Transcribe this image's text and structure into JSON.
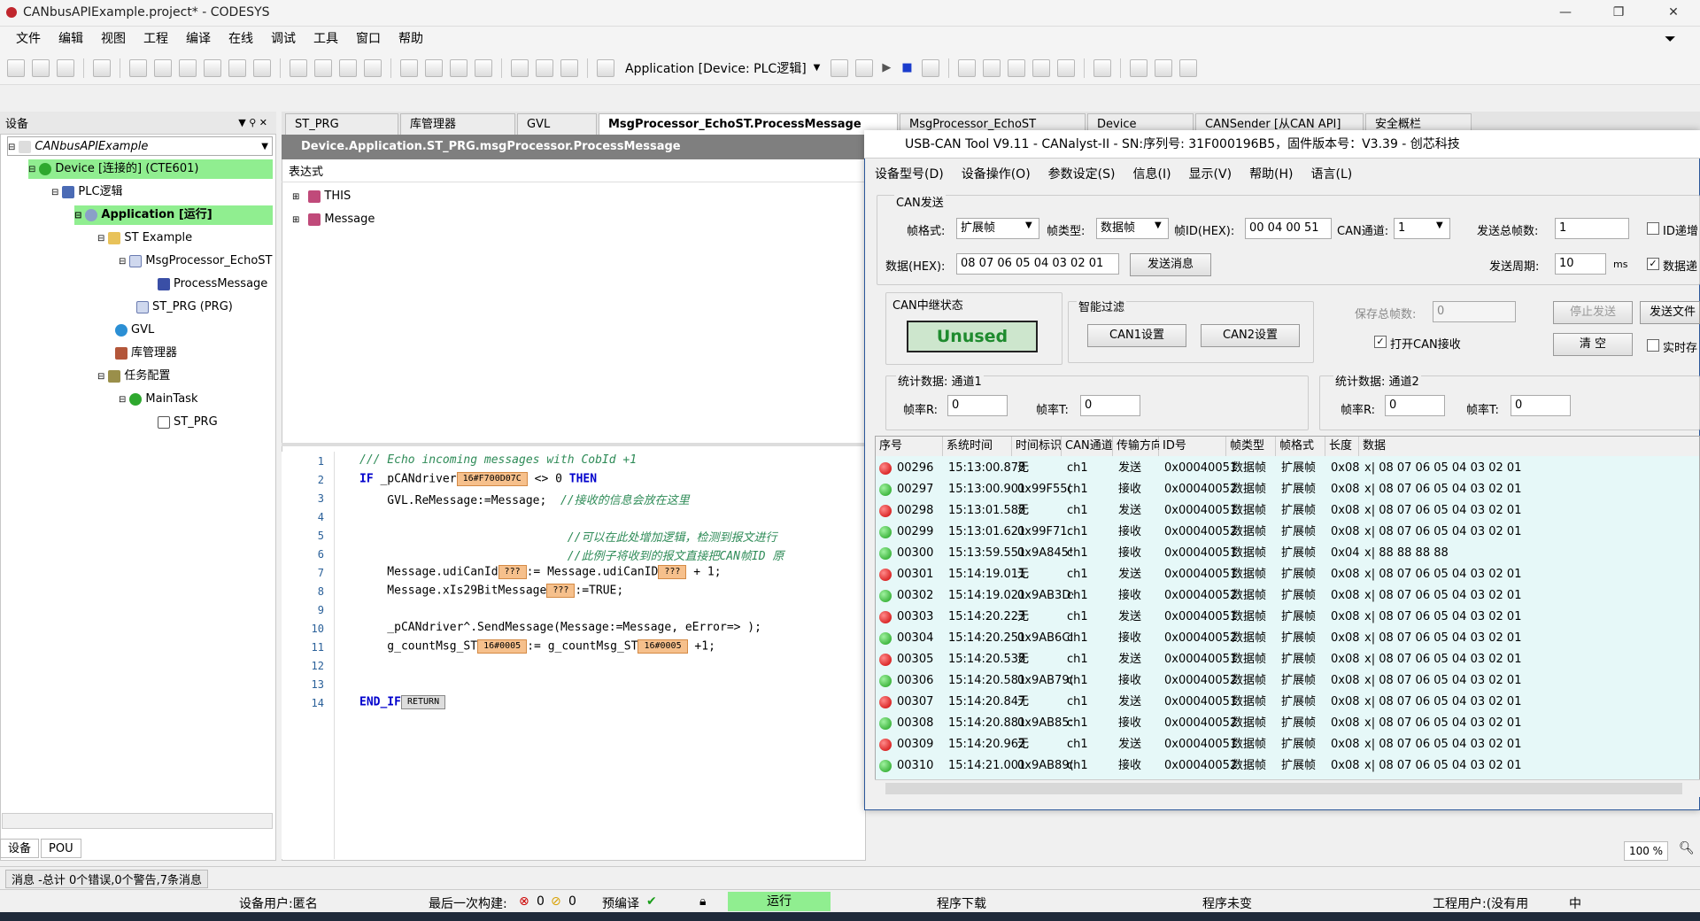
{
  "window": {
    "title": "CANbusAPIExample.project* - CODESYS",
    "min": "—",
    "max": "❐",
    "close": "✕"
  },
  "menu": [
    "文件",
    "编辑",
    "视图",
    "工程",
    "编译",
    "在线",
    "调试",
    "工具",
    "窗口",
    "帮助"
  ],
  "toolbar": {
    "app_selector": "Application [Device: PLC逻辑]"
  },
  "devices_panel": {
    "title": "设备",
    "tree": [
      {
        "label": "CANbusAPIExample",
        "icon": "project-icon"
      },
      {
        "label": "Device [连接的] (CTE601)",
        "icon": "device-icon"
      },
      {
        "label": "PLC逻辑",
        "icon": "plc-icon"
      },
      {
        "label": "Application [运行]",
        "icon": "gear-icon"
      },
      {
        "label": "ST Example",
        "icon": "folder-icon"
      },
      {
        "label": "MsgProcessor_EchoST",
        "icon": "fb-icon"
      },
      {
        "label": "ProcessMessage",
        "icon": "method-icon"
      },
      {
        "label": "ST_PRG (PRG)",
        "icon": "prg-icon"
      },
      {
        "label": "GVL",
        "icon": "globe-icon"
      },
      {
        "label": "库管理器",
        "icon": "library-icon"
      },
      {
        "label": "任务配置",
        "icon": "task-config-icon"
      },
      {
        "label": "MainTask",
        "icon": "task-icon"
      },
      {
        "label": "ST_PRG",
        "icon": "prg-icon"
      }
    ],
    "bottom_tabs": [
      "设备",
      "POU"
    ]
  },
  "doc_tabs": [
    "ST_PRG",
    "库管理器",
    "GVL",
    "MsgProcessor_EchoST.ProcessMessage",
    "MsgProcessor_EchoST",
    "Device",
    "CANSender [从CAN API]",
    "安全概栏"
  ],
  "editor": {
    "path": "Device.Application.ST_PRG.msgProcessor.ProcessMessage",
    "decl_header": "表达式",
    "decl_rows": [
      "THIS",
      "Message"
    ],
    "lines": [
      {
        "n": "1",
        "text": "/// Echo incoming messages with CobId +1"
      },
      {
        "n": "2",
        "text": "IF _pCANdriver"
      },
      {
        "n": "3",
        "text": "    GVL.ReMessage:=Message;  //接收的信息会放在这里"
      },
      {
        "n": "4",
        "text": ""
      },
      {
        "n": "5",
        "text": "                              //可以在此处增加逻辑，检测到报文进行"
      },
      {
        "n": "6",
        "text": "                              //此例子将收到的报文直接把CAN帧ID 原"
      },
      {
        "n": "7",
        "text": "    Message.udiCanId"
      },
      {
        "n": "8",
        "text": "    Message.xIs29BitMessage"
      },
      {
        "n": "9",
        "text": ""
      },
      {
        "n": "10",
        "text": "    _pCANdriver^.SendMessage(Message:=Message, eError=> );"
      },
      {
        "n": "11",
        "text": "    g_countMsg_ST"
      },
      {
        "n": "12",
        "text": ""
      },
      {
        "n": "13",
        "text": ""
      },
      {
        "n": "14",
        "text": "END_IF"
      }
    ],
    "inline": {
      "l2_badge": "16#F700D07C",
      "l2_rest": "<> 0",
      "l2_then": "THEN",
      "l7_badge1": "???",
      "l7_mid": ":= Message.udiCanID",
      "l7_badge2": "???",
      "l7_end": "+ 1;",
      "l8_badge": "???",
      "l8_end": ":=TRUE;",
      "l11_badge1": "16#0005",
      "l11_mid": ":= g_countMsg_ST",
      "l11_badge2": "16#0005",
      "l11_end": "+1;",
      "l14_badge": "RETURN"
    }
  },
  "can_tool": {
    "title": "USB-CAN Tool V9.11 - CANalyst-II - SN:序列号: 31F000196B5，固件版本号：V3.39 - 创芯科技",
    "menu": [
      "设备型号(D)",
      "设备操作(O)",
      "参数设定(S)",
      "信息(I)",
      "显示(V)",
      "帮助(H)",
      "语言(L)"
    ],
    "send": {
      "group": "CAN发送",
      "frame_format_label": "帧格式:",
      "frame_format": "扩展帧",
      "frame_type_label": "帧类型:",
      "frame_type": "数据帧",
      "frame_id_label": "帧ID(HEX):",
      "frame_id": "00 04 00 51",
      "channel_label": "CAN通道:",
      "channel": "1",
      "total_label": "发送总帧数:",
      "total": "1",
      "id_inc_label": "ID递增",
      "data_label": "数据(HEX):",
      "data": "08 07 06 05 04 03 02 01",
      "send_btn": "发送消息",
      "period_label": "发送周期:",
      "period": "10",
      "period_unit": "ms",
      "data_inc_label": "数据递"
    },
    "relay": {
      "label": "CAN中继状态",
      "value": "Unused"
    },
    "filter": {
      "label": "智能过滤",
      "can1": "CAN1设置",
      "can2": "CAN2设置"
    },
    "save_total_label": "保存总帧数:",
    "save_total": "0",
    "stop_btn": "停止发送",
    "send_file_btn": "发送文件",
    "open_recv_label": "打开CAN接收",
    "clear_btn": "清 空",
    "realtime_label": "实时存",
    "stats1": {
      "label": "统计数据: 通道1",
      "r_label": "帧率R:",
      "r": "0",
      "t_label": "帧率T:",
      "t": "0"
    },
    "stats2": {
      "label": "统计数据: 通道2",
      "r_label": "帧率R:",
      "r": "0",
      "t_label": "帧率T:",
      "t": "0"
    },
    "columns": [
      "序号",
      "系统时间",
      "时间标识",
      "CAN通道",
      "传输方向",
      "ID号",
      "帧类型",
      "帧格式",
      "长度",
      "数据"
    ],
    "rows": [
      {
        "s": "r",
        "n": "00296",
        "time": "15:13:00.878",
        "ts": "无",
        "ch": "ch1",
        "dir": "发送",
        "id": "0x00040051",
        "type": "数据帧",
        "fmt": "扩展帧",
        "len": "0x08",
        "data": "x| 08 07 06 05 04 03 02 01"
      },
      {
        "s": "g",
        "n": "00297",
        "time": "15:13:00.901",
        "ts": "0x99F55(",
        "ch": "ch1",
        "dir": "接收",
        "id": "0x00040052",
        "type": "数据帧",
        "fmt": "扩展帧",
        "len": "0x08",
        "data": "x| 08 07 06 05 04 03 02 01"
      },
      {
        "s": "r",
        "n": "00298",
        "time": "15:13:01.588",
        "ts": "无",
        "ch": "ch1",
        "dir": "发送",
        "id": "0x00040051",
        "type": "数据帧",
        "fmt": "扩展帧",
        "len": "0x08",
        "data": "x| 08 07 06 05 04 03 02 01"
      },
      {
        "s": "g",
        "n": "00299",
        "time": "15:13:01.621",
        "ts": "0x99F71:",
        "ch": "ch1",
        "dir": "接收",
        "id": "0x00040052",
        "type": "数据帧",
        "fmt": "扩展帧",
        "len": "0x08",
        "data": "x| 08 07 06 05 04 03 02 01"
      },
      {
        "s": "g",
        "n": "00300",
        "time": "15:13:59.551",
        "ts": "0x9A845!",
        "ch": "ch1",
        "dir": "接收",
        "id": "0x00040051",
        "type": "数据帧",
        "fmt": "扩展帧",
        "len": "0x04",
        "data": "x| 88 88 88 88"
      },
      {
        "s": "r",
        "n": "00301",
        "time": "15:14:19.011",
        "ts": "无",
        "ch": "ch1",
        "dir": "发送",
        "id": "0x00040051",
        "type": "数据帧",
        "fmt": "扩展帧",
        "len": "0x08",
        "data": "x| 08 07 06 05 04 03 02 01"
      },
      {
        "s": "g",
        "n": "00302",
        "time": "15:14:19.021",
        "ts": "0x9AB3D·",
        "ch": "ch1",
        "dir": "接收",
        "id": "0x00040052",
        "type": "数据帧",
        "fmt": "扩展帧",
        "len": "0x08",
        "data": "x| 08 07 06 05 04 03 02 01"
      },
      {
        "s": "r",
        "n": "00303",
        "time": "15:14:20.223",
        "ts": "无",
        "ch": "ch1",
        "dir": "发送",
        "id": "0x00040051",
        "type": "数据帧",
        "fmt": "扩展帧",
        "len": "0x08",
        "data": "x| 08 07 06 05 04 03 02 01"
      },
      {
        "s": "g",
        "n": "00304",
        "time": "15:14:20.251",
        "ts": "0x9AB6CI",
        "ch": "ch1",
        "dir": "接收",
        "id": "0x00040052",
        "type": "数据帧",
        "fmt": "扩展帧",
        "len": "0x08",
        "data": "x| 08 07 06 05 04 03 02 01"
      },
      {
        "s": "r",
        "n": "00305",
        "time": "15:14:20.538",
        "ts": "无",
        "ch": "ch1",
        "dir": "发送",
        "id": "0x00040051",
        "type": "数据帧",
        "fmt": "扩展帧",
        "len": "0x08",
        "data": "x| 08 07 06 05 04 03 02 01"
      },
      {
        "s": "g",
        "n": "00306",
        "time": "15:14:20.581",
        "ts": "0x9AB79(",
        "ch": "ch1",
        "dir": "接收",
        "id": "0x00040052",
        "type": "数据帧",
        "fmt": "扩展帧",
        "len": "0x08",
        "data": "x| 08 07 06 05 04 03 02 01"
      },
      {
        "s": "r",
        "n": "00307",
        "time": "15:14:20.847",
        "ts": "无",
        "ch": "ch1",
        "dir": "发送",
        "id": "0x00040051",
        "type": "数据帧",
        "fmt": "扩展帧",
        "len": "0x08",
        "data": "x| 08 07 06 05 04 03 02 01"
      },
      {
        "s": "g",
        "n": "00308",
        "time": "15:14:20.881",
        "ts": "0x9AB85:",
        "ch": "ch1",
        "dir": "接收",
        "id": "0x00040052",
        "type": "数据帧",
        "fmt": "扩展帧",
        "len": "0x08",
        "data": "x| 08 07 06 05 04 03 02 01"
      },
      {
        "s": "r",
        "n": "00309",
        "time": "15:14:20.962",
        "ts": "无",
        "ch": "ch1",
        "dir": "发送",
        "id": "0x00040051",
        "type": "数据帧",
        "fmt": "扩展帧",
        "len": "0x08",
        "data": "x| 08 07 06 05 04 03 02 01"
      },
      {
        "s": "g",
        "n": "00310",
        "time": "15:14:21.001",
        "ts": "0x9AB89(",
        "ch": "ch1",
        "dir": "接收",
        "id": "0x00040052",
        "type": "数据帧",
        "fmt": "扩展帧",
        "len": "0x08",
        "data": "x| 08 07 06 05 04 03 02 01"
      }
    ]
  },
  "zoom": "100 %",
  "messages": "消息 -总计 0个错误,0个警告,7条消息",
  "status": {
    "user": "设备用户:匿名",
    "last_build_label": "最后一次构建:",
    "errors": "0",
    "warnings": "0",
    "precompile": "预编译",
    "run": "运行",
    "download": "程序下载",
    "unchanged": "程序未变",
    "project_user": "工程用户:(没有用",
    "ime": "中"
  },
  "colors": {
    "highlight": "#90ee90",
    "accent": "#2b579a",
    "recv": "#1a9e1a",
    "send": "#cc0000"
  }
}
